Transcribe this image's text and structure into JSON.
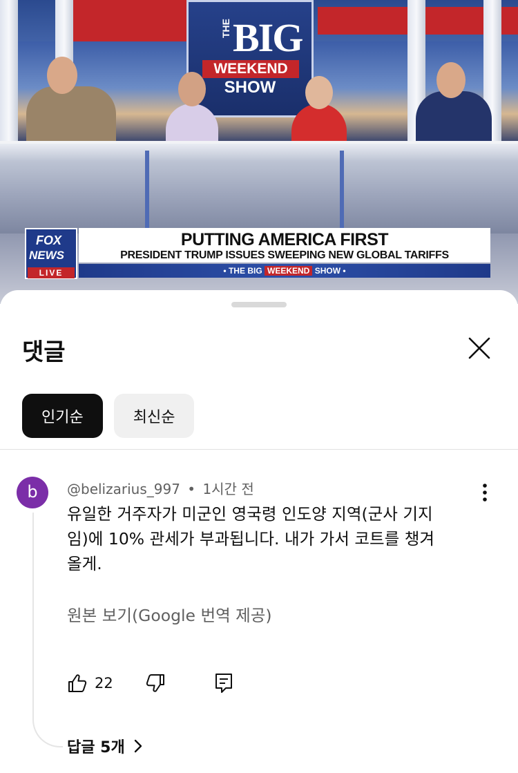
{
  "video": {
    "show_logo": {
      "the": "THE",
      "big": "BIG",
      "weekend": "WEEKEND",
      "show": "SHOW"
    },
    "network": {
      "line1": "FOX",
      "line2": "NEWS",
      "live": "LIVE"
    },
    "headline": "PUTTING AMERICA FIRST",
    "subheadline": "PRESIDENT TRUMP ISSUES SWEEPING NEW GLOBAL TARIFFS",
    "banner": {
      "prefix": "• THE",
      "big": "BIG",
      "weekend": "WEEKEND",
      "show": "SHOW •"
    }
  },
  "sheet": {
    "title": "댓글",
    "sort_chips": [
      {
        "label": "인기순",
        "active": true
      },
      {
        "label": "최신순",
        "active": false
      }
    ]
  },
  "comment": {
    "avatar_letter": "b",
    "avatar_color": "#7b2ea8",
    "author": "@belizarius_997",
    "separator": "•",
    "time": "1시간 전",
    "text_lines": [
      "유일한 거주자가 미군인 영국령 인도양 지역(군사 기지",
      "임)에 10% 관세가 부과됩니다. 내가 가서 코트를 챙겨",
      "올게."
    ],
    "translate_link": "원본 보기(Google 번역 제공)",
    "like_count": "22",
    "replies_label": "답글 5개"
  },
  "colors": {
    "active_chip": "#0f0f0f",
    "inactive_chip": "#f0f0f0",
    "meta_text": "#606060",
    "fox_blue": "#1f3a8a",
    "fox_red": "#c3262a"
  }
}
